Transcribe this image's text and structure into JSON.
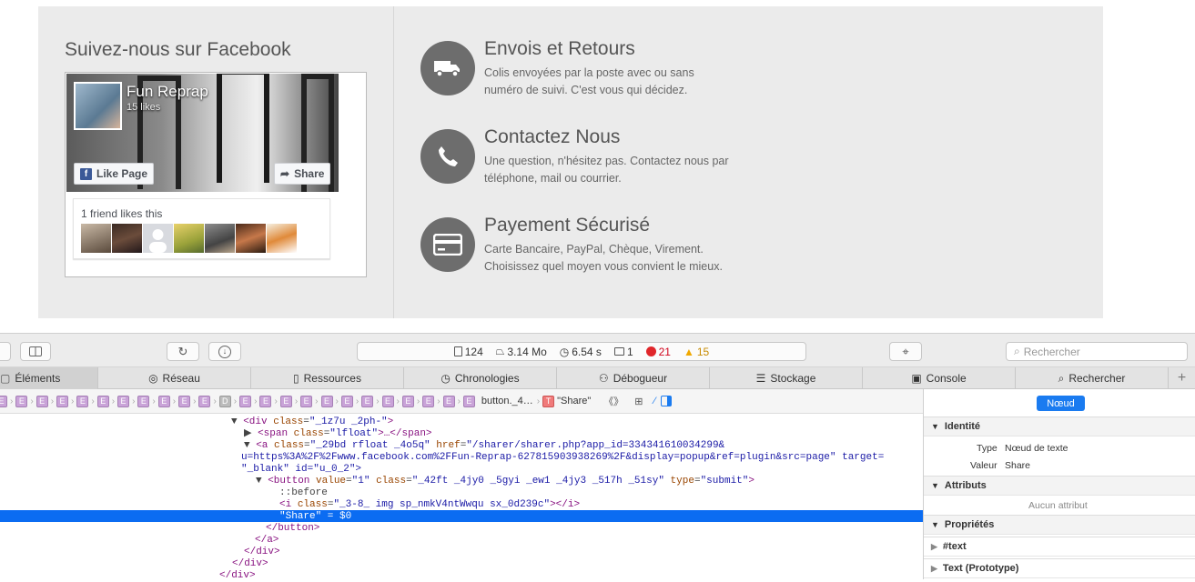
{
  "facebook": {
    "heading": "Suivez-nous sur Facebook",
    "page_name": "Fun Reprap",
    "likes": "15 likes",
    "like_button": "Like Page",
    "share_button": "Share",
    "friends_text": "1 friend likes this"
  },
  "services": [
    {
      "icon": "truck-icon",
      "title": "Envois et Retours",
      "line1": "Colis envoyées par la poste avec ou sans",
      "line2": "numéro de suivi. C'est vous qui décidez."
    },
    {
      "icon": "phone-icon",
      "title": "Contactez Nous",
      "line1": "Une question, n'hésitez pas. Contactez nous par",
      "line2": "téléphone, mail ou courrier."
    },
    {
      "icon": "credit-card-icon",
      "title": "Payement Sécurisé",
      "line1": "Carte Bancaire, PayPal, Chèque, Virement.",
      "line2": "Choisissez quel moyen vous convient le mieux."
    }
  ],
  "devtools": {
    "status": {
      "resources": "124",
      "size": "3.14 Mo",
      "time": "6.54 s",
      "logs": "1",
      "errors": "21",
      "warnings": "15"
    },
    "search_placeholder": "Rechercher",
    "tabs": [
      "Éléments",
      "Réseau",
      "Ressources",
      "Chronologies",
      "Débogueur",
      "Stockage",
      "Console",
      "Rechercher"
    ],
    "breadcrumb_button": "button._4…",
    "breadcrumb_text": "\"Share\"",
    "tree": [
      {
        "pre": "▼ ",
        "tag": "<div ",
        "attrs": [
          [
            "class",
            "\"_1z7u _2ph-\""
          ]
        ],
        "end": ">"
      },
      {
        "pre": "▶ ",
        "tag": "<span ",
        "attrs": [
          [
            "class",
            "\"lfloat\""
          ]
        ],
        "end": ">…</span>"
      },
      {
        "pre": "▼ ",
        "tag": "<a ",
        "attrs": [
          [
            "class",
            "\"_29bd rfloat _4o5q\""
          ],
          [
            "href",
            "\"/sharer/sharer.php?app_id=334341610034299&"
          ]
        ],
        "end": ""
      },
      {
        "pre": "",
        "tag": "",
        "attrs": [],
        "end": "u=https%3A%2F%2Fwww.facebook.com%2FFun-Reprap-627815903938269%2F&display=popup&ref=plugin&src=page\" target="
      },
      {
        "pre": "",
        "tag": "",
        "attrs": [],
        "end": "\"_blank\" id=\"u_0_2\">"
      },
      {
        "pre": "▼ ",
        "tag": "<button ",
        "attrs": [
          [
            "value",
            "\"1\""
          ],
          [
            "class",
            "\"_42ft _4jy0 _5gyi _ew1 _4jy3 _517h _51sy\""
          ],
          [
            "type",
            "\"submit\""
          ]
        ],
        "end": ">"
      },
      {
        "pre": "",
        "tag": "",
        "attrs": [],
        "end": "::before"
      },
      {
        "pre": "",
        "tag": "<i ",
        "attrs": [
          [
            "class",
            "\"_3-8_ img sp_nmkV4ntWwqu sx_0d239c\""
          ]
        ],
        "end": "></i>"
      },
      {
        "pre": "",
        "tag": "",
        "attrs": [],
        "end": "\"Share\" = $0"
      },
      {
        "pre": "",
        "tag": "",
        "attrs": [],
        "end": "</button>"
      },
      {
        "pre": "",
        "tag": "",
        "attrs": [],
        "end": "</a>"
      },
      {
        "pre": "",
        "tag": "",
        "attrs": [],
        "end": "</div>"
      },
      {
        "pre": "",
        "tag": "",
        "attrs": [],
        "end": "</div>"
      },
      {
        "pre": "",
        "tag": "",
        "attrs": [],
        "end": "</div>"
      }
    ],
    "sidebar": {
      "node_button": "Nœud",
      "identity": "Identité",
      "type_label": "Type",
      "type_value": "Nœud de texte",
      "value_label": "Valeur",
      "value_value": "Share",
      "attributes": "Attributs",
      "no_attributes": "Aucun attribut",
      "properties": "Propriétés",
      "text_node": "#text",
      "text_proto": "Text (Prototype)"
    }
  }
}
